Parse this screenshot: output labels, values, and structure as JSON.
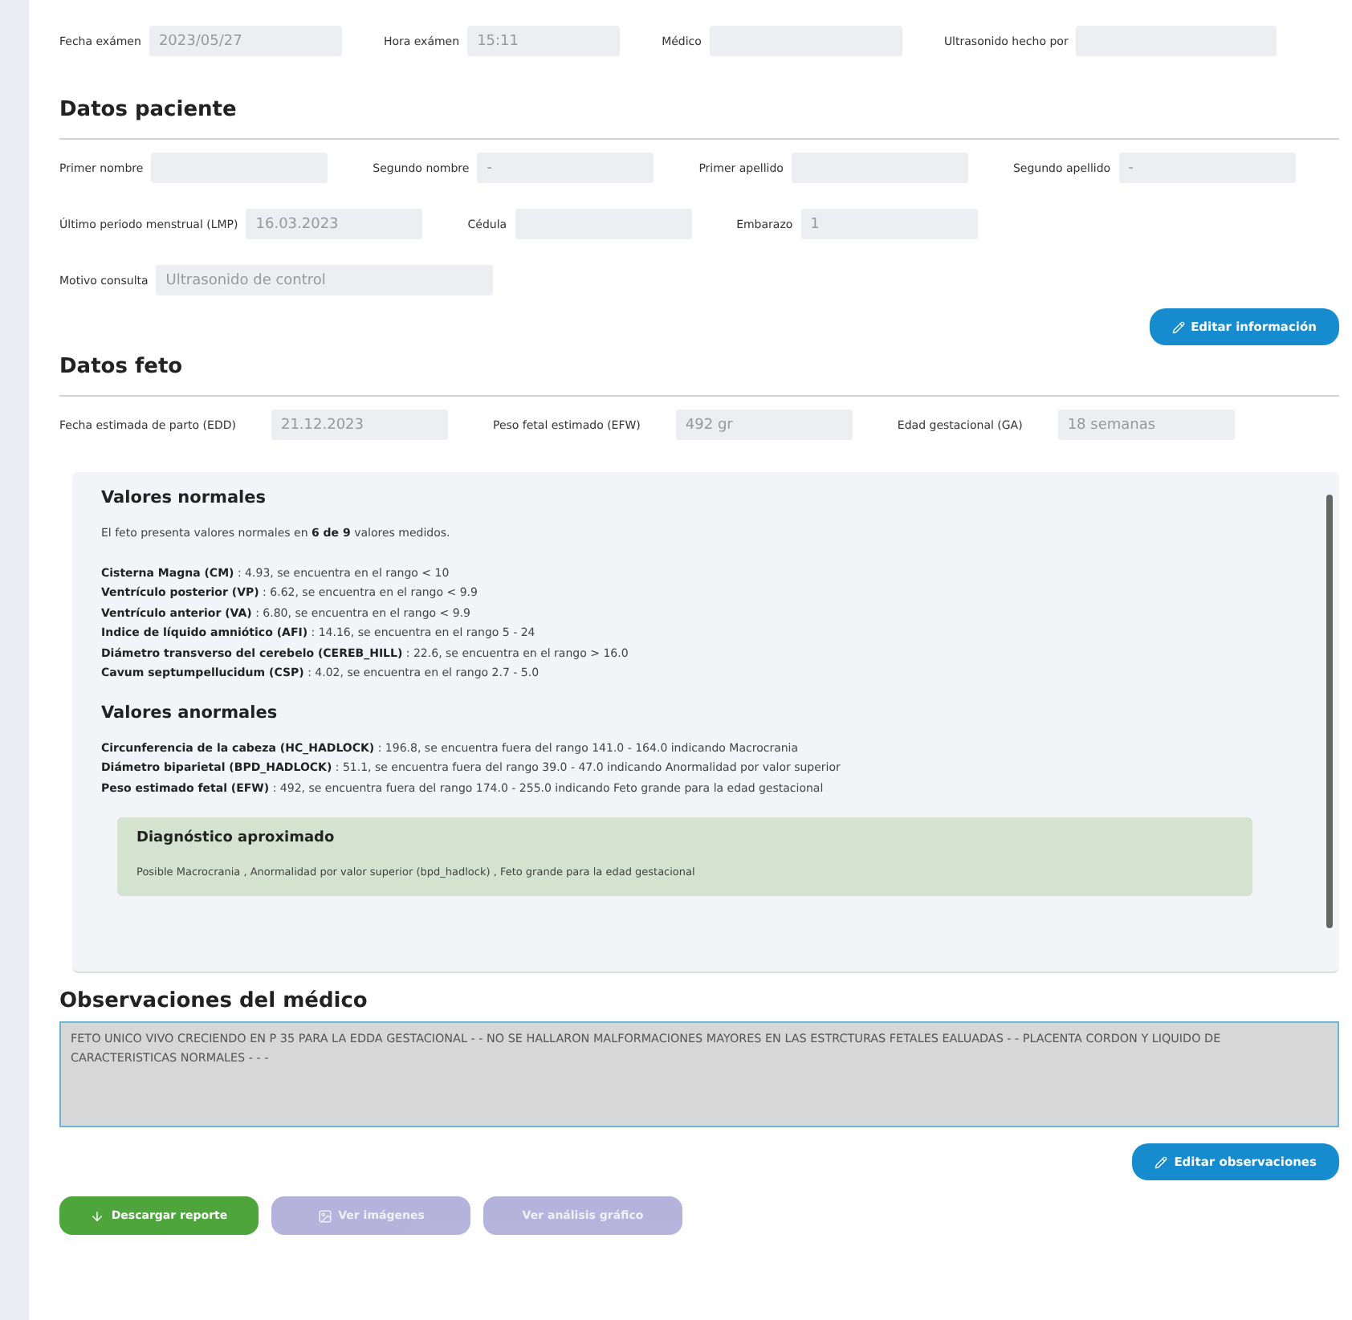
{
  "exam": [
    {
      "label": "Fecha exámen",
      "value": "2023/05/27"
    },
    {
      "label": "Hora exámen",
      "value": "15:11"
    },
    {
      "label": "Médico"
    },
    {
      "label": "Ultrasonido hecho por"
    }
  ],
  "patient": {
    "title": "Datos paciente",
    "rows": [
      [
        {
          "label": "Primer nombre"
        },
        {
          "label": "Segundo nombre",
          "value": "-"
        },
        {
          "label": "Primer apellido"
        },
        {
          "label": "Segundo apellido",
          "value": "-"
        }
      ],
      [
        {
          "label": "Último periodo menstrual (LMP)",
          "value": "16.03.2023"
        },
        {
          "label": "Cédula"
        },
        {
          "label": "Embarazo",
          "value": "1"
        }
      ],
      [
        {
          "label": "Motivo consulta",
          "value": "Ultrasonido de control",
          "wide": true
        }
      ]
    ],
    "edit_button": "Editar información"
  },
  "fetus": {
    "title": "Datos feto",
    "fields": [
      {
        "label": "Fecha estimada de parto (EDD)",
        "value": "21.12.2023"
      },
      {
        "label": "Peso fetal estimado (EFW)",
        "value": "492 gr"
      },
      {
        "label": "Edad gestacional (GA)",
        "value": "18 semanas"
      }
    ]
  },
  "results": {
    "normal_title": "Valores normales",
    "summary": "El feto presenta valores normales en **6 de 9** valores medidos.",
    "normal": [
      "**Cisterna Magna (CM)** : 4.93, se encuentra en el rango < 10",
      "**Ventrículo posterior (VP)** : 6.62, se encuentra en el rango < 9.9",
      "**Ventrículo anterior (VA)** : 6.80, se encuentra en el rango < 9.9",
      "**Indice de líquido amniótico (AFI)** : 14.16, se encuentra en el rango 5 - 24",
      "**Diámetro transverso del cerebelo (CEREB_HILL)** : 22.6, se encuentra en el rango > 16.0",
      "**Cavum septumpellucidum (CSP)** : 4.02, se encuentra en el rango 2.7 - 5.0"
    ],
    "abnormal_title": "Valores anormales",
    "abnormal": [
      "**Circunferencia de la cabeza (HC_HADLOCK)** : 196.8, se encuentra fuera del rango 141.0 - 164.0 indicando Macrocrania",
      "**Diámetro biparietal (BPD_HADLOCK)** : 51.1, se encuentra fuera del rango 39.0 - 47.0 indicando Anormalidad por valor superior",
      "**Peso estimado fetal (EFW)** : 492, se encuentra fuera del rango 174.0 - 255.0 indicando Feto grande para la edad gestacional"
    ],
    "diagnosis_title": "Diagnóstico aproximado",
    "diagnosis": "Posible Macrocrania , Anormalidad por valor superior (bpd_hadlock) , Feto grande para la edad gestacional"
  },
  "observations": {
    "title": "Observaciones del médico",
    "value": "FETO UNICO VIVO CRECIENDO EN P 35 PARA LA EDDA GESTACIONAL -  - NO SE HALLARON MALFORMACIONES  MAYORES EN LAS ESTRCTURAS FETALES EALUADAS -  - PLACENTA CORDON Y LIQUIDO DE CARACTERISTICAS NORMALES  -  -  -",
    "edit_button": "Editar observaciones"
  },
  "actions": [
    {
      "label": "Descargar reporte",
      "kind": "download",
      "disabled": false
    },
    {
      "label": "Ver imágenes",
      "kind": "images",
      "disabled": true
    },
    {
      "label": "Ver análisis gráfico",
      "kind": "chart",
      "disabled": true
    }
  ]
}
